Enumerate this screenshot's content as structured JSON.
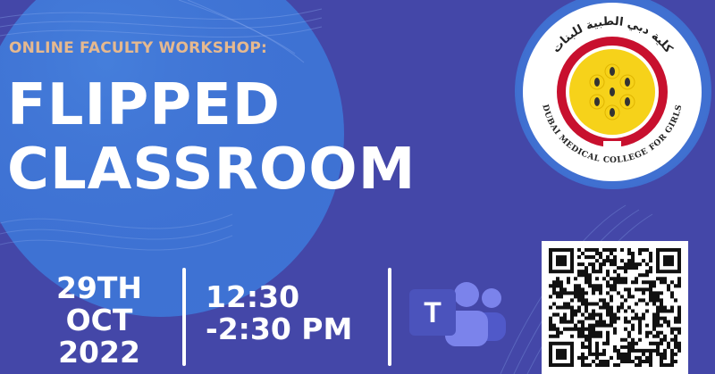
{
  "event": {
    "subtitle": "ONLINE FACULTY WORKSHOP:",
    "title_line1": "FLIPPED",
    "title_line2": "CLASSROOM",
    "date_line1": "29TH",
    "date_line2": "OCT",
    "date_line3": "2022",
    "time_line1": "12:30",
    "time_line2": "-2:30 PM"
  },
  "platform": {
    "icon": "microsoft-teams-icon",
    "letter": "T"
  },
  "logo": {
    "arabic_text": "كلية دبي الطبية للبنات",
    "english_text": "DUBAI MEDICAL COLLEGE FOR GIRLS"
  },
  "colors": {
    "background": "#4447a8",
    "light_circle": "#3f6fd0",
    "subtitle": "#e6b98f",
    "text": "#ffffff",
    "teams_purple": "#7b83eb",
    "logo_red": "#c8102e",
    "logo_yellow": "#f6d21a"
  }
}
